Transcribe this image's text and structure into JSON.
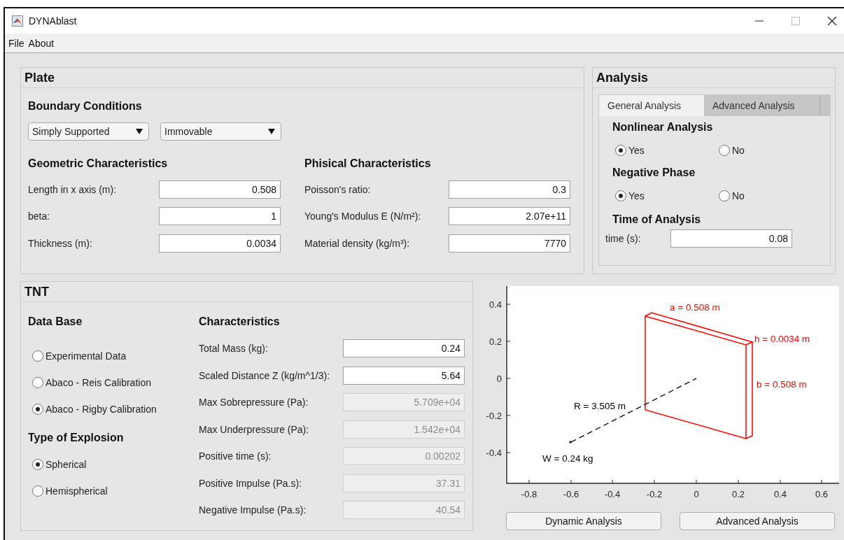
{
  "window": {
    "title": "DYNAblast"
  },
  "menu": [
    "File",
    "About"
  ],
  "plate": {
    "title": "Plate",
    "boundary_conditions": {
      "title": "Boundary Conditions",
      "dropdowns": [
        {
          "value": "Simply Supported"
        },
        {
          "value": "Immovable"
        }
      ]
    },
    "geometric": {
      "title": "Geometric Characteristics",
      "fields": [
        {
          "label": "Length in x axis (m):",
          "value": "0.508"
        },
        {
          "label": "beta:",
          "value": "1"
        },
        {
          "label": "Thickness (m):",
          "value": "0.0034"
        }
      ]
    },
    "physical": {
      "title": "Phisical Characteristics",
      "fields": [
        {
          "label": "Poisson's ratio:",
          "value": "0.3"
        },
        {
          "label": "Young's Modulus E (N/m²):",
          "value": "2.07e+11"
        },
        {
          "label": "Material density (kg/m³):",
          "value": "7770"
        }
      ]
    }
  },
  "analysis": {
    "title": "Analysis",
    "tabs": [
      {
        "label": "General Analysis",
        "selected": true
      },
      {
        "label": "Advanced Analysis",
        "selected": false
      }
    ],
    "groups": [
      {
        "title": "Nonlinear Analysis",
        "options": [
          {
            "label": "Yes",
            "selected": true
          },
          {
            "label": "No",
            "selected": false
          }
        ]
      },
      {
        "title": "Negative Phase",
        "options": [
          {
            "label": "Yes",
            "selected": true
          },
          {
            "label": "No",
            "selected": false
          }
        ]
      }
    ],
    "time": {
      "title": "Time of Analysis",
      "label": "time (s):",
      "value": "0.08"
    }
  },
  "tnt": {
    "title": "TNT",
    "database": {
      "title": "Data Base",
      "options": [
        {
          "label": "Experimental Data",
          "selected": false
        },
        {
          "label": "Abaco - Reis Calibration",
          "selected": false
        },
        {
          "label": "Abaco - Rigby Calibration",
          "selected": true
        }
      ]
    },
    "explosion": {
      "title": "Type of Explosion",
      "options": [
        {
          "label": "Spherical",
          "selected": true
        },
        {
          "label": "Hemispherical",
          "selected": false
        }
      ]
    },
    "characteristics": {
      "title": "Characteristics",
      "fields": [
        {
          "label": "Total Mass (kg):",
          "value": "0.24",
          "disabled": false
        },
        {
          "label": "Scaled Distance Z (kg/m^1/3):",
          "value": "5.64",
          "disabled": false
        },
        {
          "label": "Max Sobrepressure (Pa):",
          "value": "5.709e+04",
          "disabled": true
        },
        {
          "label": "Max Underpressure (Pa):",
          "value": "1.542e+04",
          "disabled": true
        },
        {
          "label": "Positive time (s):",
          "value": "0.00202",
          "disabled": true
        },
        {
          "label": "Positive Impulse (Pa.s):",
          "value": "37.31",
          "disabled": true
        },
        {
          "label": "Negative Impulse (Pa.s):",
          "value": "40.54",
          "disabled": true
        }
      ]
    }
  },
  "plot": {
    "yticks": [
      "0.4",
      "0.2",
      "0",
      "-0.2",
      "-0.4"
    ],
    "xticks": [
      "-0.8",
      "-0.6",
      "-0.4",
      "-0.2",
      "0",
      "0.2",
      "0.4",
      "0.6"
    ],
    "annotations": [
      {
        "text": "a = 0.508 m",
        "color": "#ff0000"
      },
      {
        "text": "h = 0.0034 m",
        "color": "#ff0000"
      },
      {
        "text": "b = 0.508 m",
        "color": "#ff0000"
      },
      {
        "text": "R = 3.505 m",
        "color": "#000000"
      },
      {
        "text": "W = 0.24 kg",
        "color": "#000000"
      }
    ]
  },
  "buttons": [
    "Dynamic Analysis",
    "Advanced Analysis"
  ]
}
